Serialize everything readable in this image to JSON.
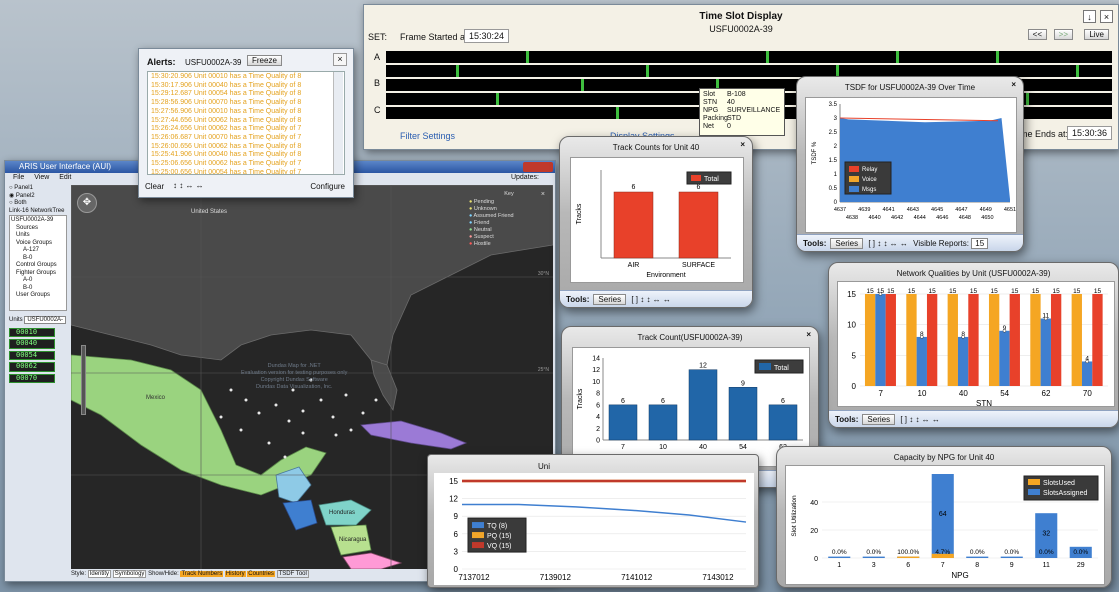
{
  "tsd": {
    "title": "Time Slot Display",
    "subtitle": "USFU0002A-39",
    "set_label": "SET:",
    "frame_started_label": "Frame Started at:",
    "frame_started_value": "15:30:24",
    "frame_ends_label": "Frame Ends at:",
    "frame_ends_value": "15:30:36",
    "rows": [
      "A",
      "B",
      "C"
    ],
    "nav_prev": "<<",
    "nav_next": ">>",
    "live": "Live",
    "filter_settings": "Filter Settings",
    "display_settings": "Display Settings",
    "tooltip": {
      "slot_k": "Slot",
      "slot_v": "B-108",
      "stn_k": "STN",
      "stn_v": "40",
      "npg_k": "NPG",
      "npg_v": "SURVEILLANCE",
      "packing_k": "Packing",
      "packing_v": "STD",
      "net_k": "Net",
      "net_v": "0"
    }
  },
  "alerts": {
    "title": "Alerts:",
    "unit": "USFU0002A-39",
    "freeze": "Freeze",
    "clear": "Clear",
    "configure": "Configure",
    "lines": [
      "15:30:20.906  Unit 00010 has a Time Quality of 8",
      "15:30:17.906  Unit 00040 has a Time Quality of 8",
      "15:29:12.687  Unit 00054 has a Time Quality of 8",
      "15:28:56.906  Unit 00070 has a Time Quality of 8",
      "15:27:56.906  Unit 00010 has a Time Quality of 8",
      "15:27:44.656  Unit 00062 has a Time Quality of 8",
      "15:26:24.656  Unit 00062 has a Time Quality of 7",
      "15:26:06.687  Unit 00070 has a Time Quality of 7",
      "15:26:00.656  Unit 00062 has a Time Quality of 8",
      "15:25:41.906  Unit 00040 has a Time Quality of 8",
      "15:25:06.656  Unit 00062 has a Time Quality of 7",
      "15:25:00.656  Unit 00054 has a Time Quality of 7",
      "15:24:42.687  Unit 00070 has a Time Quality of 8"
    ]
  },
  "aris": {
    "title": "ARIS User Interface (AUI)",
    "menu": [
      "File",
      "View",
      "Edit"
    ],
    "updates": "Updates:",
    "panels": [
      "Panel1",
      "Panel2",
      "Both"
    ],
    "tree_root": "Link-16 NetworkTree",
    "tree": [
      "USFU0002A-39",
      "Sources",
      "Units",
      "Voice Groups",
      "A-127",
      "B-0",
      "Control Groups",
      "Fighter Groups",
      "A-0",
      "B-0",
      "User Groups"
    ],
    "units_label": "Units",
    "units_value": "USFU0002A-",
    "unit_ids": [
      "00010",
      "00040",
      "00054",
      "00062",
      "00070"
    ],
    "map_labels": {
      "us": "United States",
      "mexico": "Mexico",
      "honduras": "Honduras",
      "nicaragua": "Nicaragua",
      "lat30": "30°N",
      "lat25": "25°N"
    },
    "map_watermark": [
      "Dundas Map for .NET",
      "Evaluation version for testing purposes only",
      "Copyright Dundas Software",
      "Dundas Data Visualization, Inc."
    ],
    "key_title": "Key",
    "key_items": [
      {
        "label": "Pending",
        "color": "#e8e070"
      },
      {
        "label": "Unknown",
        "color": "#e8e070"
      },
      {
        "label": "Assumed Friend",
        "color": "#7fd3ff"
      },
      {
        "label": "Friend",
        "color": "#7fd3ff"
      },
      {
        "label": "Neutral",
        "color": "#8fe08f"
      },
      {
        "label": "Suspect",
        "color": "#ff9a9a"
      },
      {
        "label": "Hostile",
        "color": "#ff5a5a"
      }
    ],
    "status": [
      "Style:",
      "Identity",
      "Symbology",
      "Show/Hide:",
      "Track Numbers",
      "History",
      "Countries",
      "TSDF Tool"
    ]
  },
  "tools": {
    "label": "Tools:",
    "series": "Series",
    "visible_reports": "Visible Reports:",
    "visible_reports_value": "15"
  },
  "chart_data": [
    {
      "type": "bar",
      "title": "Track Counts for Unit 40",
      "xlabel": "Environment",
      "ylabel": "Tracks",
      "categories": [
        "AIR",
        "SURFACE"
      ],
      "series": [
        {
          "name": "Total",
          "values": [
            6,
            6
          ],
          "color": "#e8412a"
        }
      ],
      "ylim": [
        0,
        8
      ]
    },
    {
      "type": "area",
      "title": "TSDF for USFU0002A-39 Over Time",
      "ylabel": "TSDF %",
      "ylim": [
        0,
        3.5
      ],
      "yticks": [
        0,
        0.5,
        1,
        1.5,
        2,
        2.5,
        3,
        3.5
      ],
      "xticks_top": [
        "4637",
        "4639",
        "4641",
        "4643",
        "4645",
        "4647",
        "4649",
        "4651"
      ],
      "xticks_bottom": [
        "4638",
        "4640",
        "4642",
        "4644",
        "4646",
        "4648",
        "4650"
      ],
      "series": [
        {
          "name": "Relay",
          "color": "#e8412a"
        },
        {
          "name": "Voice",
          "color": "#f2a62a"
        },
        {
          "name": "Msgs",
          "color": "#3f7fd0"
        }
      ],
      "legend": "bottom-left"
    },
    {
      "type": "bar",
      "title": "Network Qualities by Unit (USFU0002A-39)",
      "xlabel": "STN",
      "categories": [
        "7",
        "10",
        "40",
        "54",
        "62",
        "70"
      ],
      "series": [
        {
          "name": "",
          "color": "#f5a623",
          "values": [
            15,
            15,
            15,
            15,
            15,
            15
          ]
        },
        {
          "name": "",
          "color": "#3f7fd0",
          "values": [
            15,
            8,
            8,
            9,
            11,
            4
          ]
        },
        {
          "name": "",
          "color": "#e8412a",
          "values": [
            15,
            15,
            15,
            15,
            15,
            15
          ]
        }
      ],
      "value_labels": [
        [
          "15",
          "15",
          "15"
        ],
        [
          "15",
          "8",
          "15"
        ],
        [
          "15",
          "8",
          "15"
        ],
        [
          "15",
          "9",
          "15"
        ],
        [
          "15",
          "11",
          "15"
        ],
        [
          "15",
          "4",
          "15"
        ]
      ],
      "ylim": [
        0,
        15
      ],
      "yticks": [
        0,
        5,
        10,
        15
      ]
    },
    {
      "type": "bar",
      "title": "Track Count(USFU0002A-39)",
      "xlabel": "STN",
      "ylabel": "Tracks",
      "categories": [
        "7",
        "10",
        "40",
        "54",
        "62"
      ],
      "series": [
        {
          "name": "Total",
          "values": [
            6,
            6,
            12,
            9,
            6
          ],
          "color": "#2166a8"
        }
      ],
      "ylim": [
        0,
        14
      ],
      "yticks": [
        0,
        2,
        4,
        6,
        8,
        10,
        12,
        14
      ]
    },
    {
      "type": "line",
      "title": "Uni",
      "xticks": [
        "7137012",
        "7139012",
        "7141012",
        "7143012"
      ],
      "ylim": [
        0,
        15
      ],
      "yticks": [
        0,
        3,
        6,
        9,
        12,
        15
      ],
      "series": [
        {
          "name": "TQ (8)",
          "color": "#3f7fd0",
          "values": [
            11,
            11,
            10.6,
            10,
            9.2,
            8
          ]
        },
        {
          "name": "PQ (15)",
          "color": "#f2a62a",
          "values": [
            15,
            15,
            15,
            15,
            15,
            15
          ]
        },
        {
          "name": "VQ (15)",
          "color": "#c0392b",
          "values": [
            15,
            15,
            15,
            15,
            15,
            15
          ]
        }
      ]
    },
    {
      "type": "bar",
      "title": "Capacity by NPG for Unit 40",
      "xlabel": "NPG",
      "ylabel": "Slot Utilization",
      "categories": [
        "1",
        "3",
        "6",
        "7",
        "8",
        "9",
        "11",
        "29"
      ],
      "series": [
        {
          "name": "SlotsUsed",
          "color": "#f5a623",
          "values": [
            0,
            0,
            1,
            3,
            0,
            0,
            0,
            0
          ]
        },
        {
          "name": "SlotsAssigned",
          "color": "#3f7fd0",
          "values": [
            1,
            1,
            1,
            64,
            1,
            1,
            32,
            8
          ]
        }
      ],
      "value_labels": [
        "0.0%",
        "0.0%",
        "100.0%",
        "4.7%",
        "0.0%",
        "0.0%",
        "0.0%",
        "0.0%"
      ],
      "top_labels": {
        "7": "64",
        "11": "32"
      },
      "ylim": [
        0,
        60
      ],
      "yticks": [
        0,
        20,
        40
      ]
    }
  ]
}
